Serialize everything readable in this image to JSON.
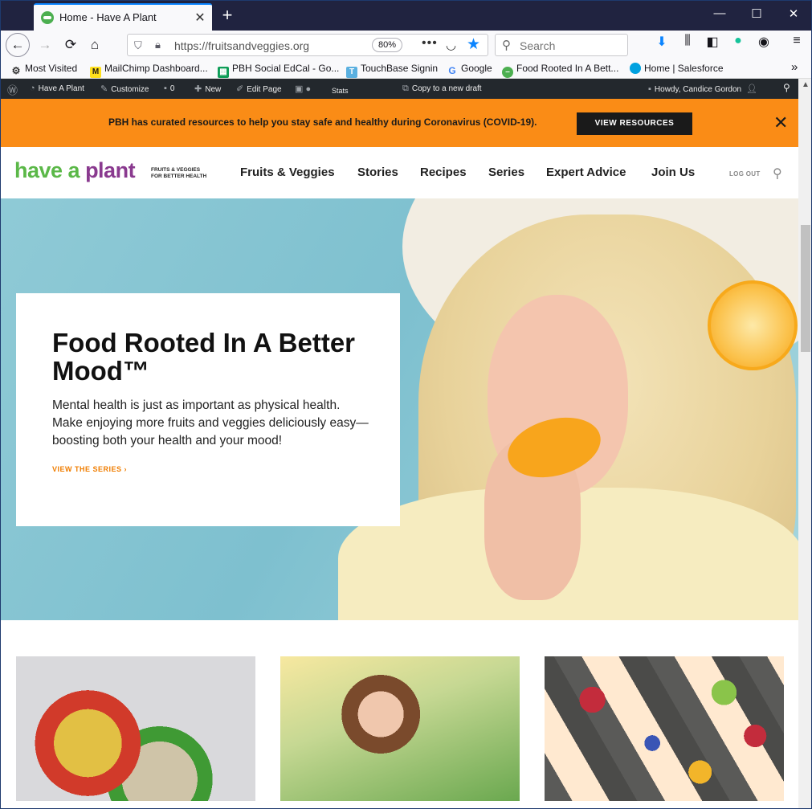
{
  "browser": {
    "tab_title": "Home - Have A Plant",
    "tab_close": "✕",
    "new_tab": "+",
    "window_controls": {
      "minimize": "—",
      "maximize": "☐",
      "close": "✕"
    },
    "url": "https://fruitsandveggies.org",
    "zoom": "80%",
    "search_placeholder": "Search",
    "nav": {
      "back": "←",
      "forward": "→",
      "reload": "⟳",
      "home": "⌂"
    },
    "url_more": "•••",
    "toolbar_icons": [
      "download-icon",
      "library-icon",
      "sidebar-icon",
      "grammarly-icon",
      "account-icon",
      "menu-icon"
    ]
  },
  "bookmarks": [
    {
      "label": "Most Visited",
      "icon": "gear-icon"
    },
    {
      "label": "MailChimp Dashboard...",
      "icon": "mailchimp-icon"
    },
    {
      "label": "PBH Social EdCal - Go...",
      "icon": "sheets-icon"
    },
    {
      "label": "TouchBase Signin",
      "icon": "touchbase-icon"
    },
    {
      "label": "Google",
      "icon": "google-icon"
    },
    {
      "label": "Food Rooted In A Bett...",
      "icon": "haveaplant-icon"
    },
    {
      "label": "Home | Salesforce",
      "icon": "salesforce-icon"
    }
  ],
  "bookmarks_overflow": "»",
  "wp_admin": {
    "site": "Have A Plant",
    "customize": "Customize",
    "comments": "0",
    "new": "New",
    "edit_page": "Edit Page",
    "stats": "Stats",
    "copy_draft": "Copy to a new draft",
    "howdy": "Howdy, Candice Gordon"
  },
  "covid_banner": {
    "text": "PBH has curated resources to help you stay safe and healthy during Coronavirus (COVID-19).",
    "button": "VIEW RESOURCES",
    "close": "✕"
  },
  "site_nav": {
    "logo_part1": "have a ",
    "logo_part2": "plant",
    "logo_tag_line1": "FRUITS & VEGGIES",
    "logo_tag_line2": "FOR BETTER HEALTH",
    "links": [
      "Fruits & Veggies",
      "Stories",
      "Recipes",
      "Series",
      "Expert Advice",
      "Join Us"
    ],
    "logout": "LOG OUT"
  },
  "hero": {
    "title": "Food Rooted In A Better Mood™",
    "body": "Mental health is just as important as physical health. Make enjoying more fruits and veggies deliciously easy—boosting both your health and your mood!",
    "link": "VIEW THE SERIES  ›"
  },
  "colors": {
    "banner": "#fa8c16",
    "logo_green": "#5bb848",
    "logo_purple": "#8a3a8f",
    "link_orange": "#f07d00",
    "wp_bar": "#23282d"
  }
}
